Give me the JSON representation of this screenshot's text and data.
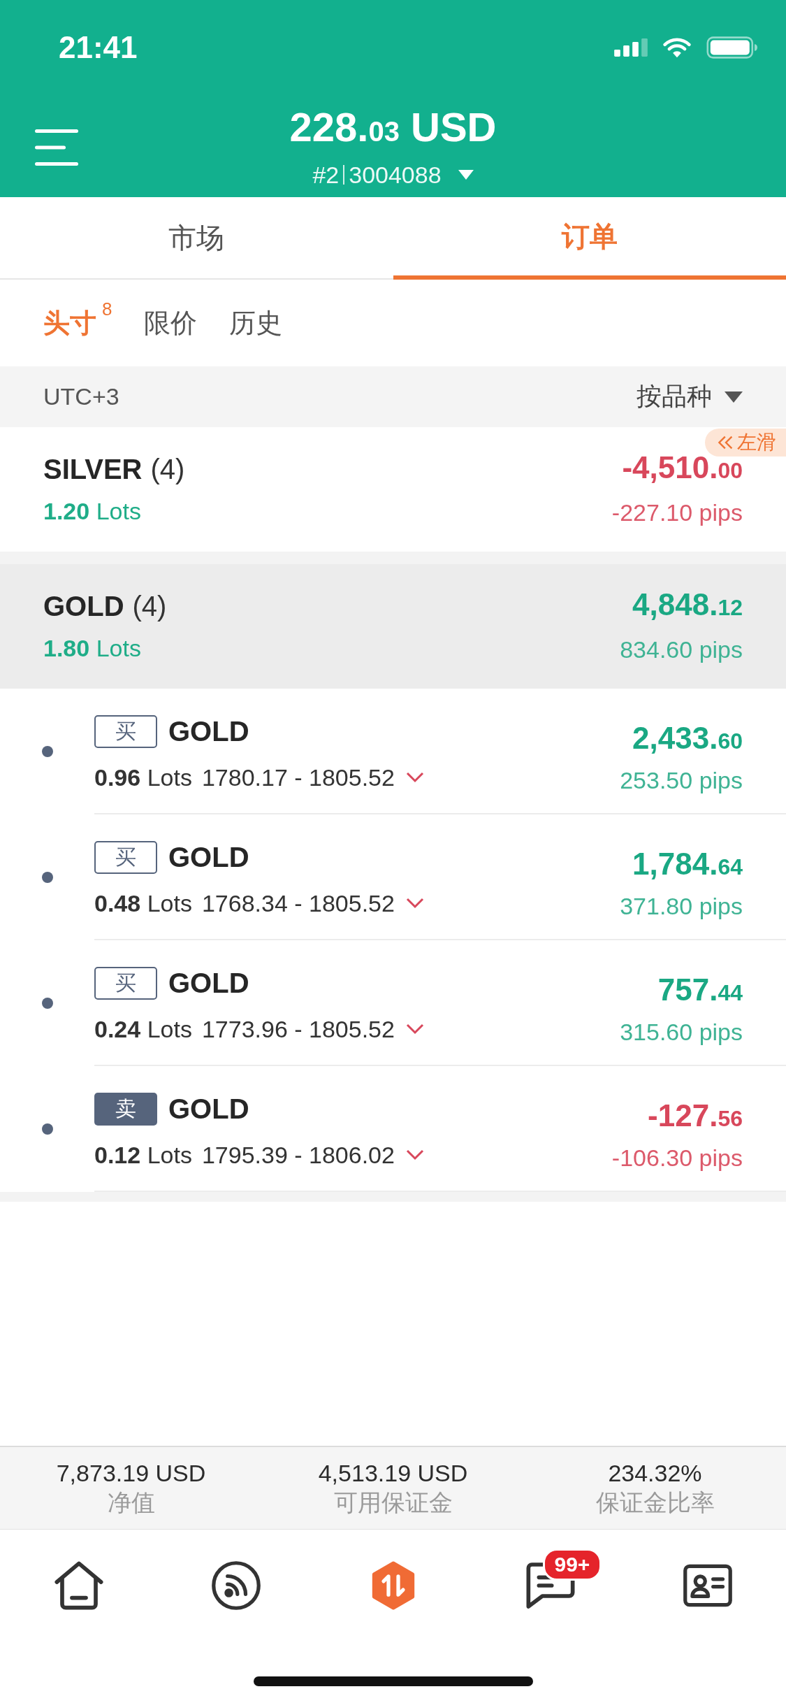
{
  "status_bar": {
    "time": "21:41"
  },
  "header": {
    "balance": {
      "whole": "228.",
      "fraction": "03",
      "currency": "USD"
    },
    "account": {
      "number": "#2",
      "id": "3004088"
    }
  },
  "tabs": [
    {
      "label": "市场",
      "selected": false
    },
    {
      "label": "订单",
      "selected": true
    }
  ],
  "sub_tabs": [
    {
      "label": "头寸",
      "count": "8",
      "selected": true
    },
    {
      "label": "限价",
      "selected": false
    },
    {
      "label": "历史",
      "selected": false
    }
  ],
  "filter_bar": {
    "timezone": "UTC+3",
    "sort": "按品种"
  },
  "groups": [
    {
      "symbol": "SILVER",
      "count": "(4)",
      "lots": "1.20",
      "lots_unit": "Lots",
      "pnl_whole": "-4,510.",
      "pnl_fraction": "00",
      "pips": "-227.10 pips",
      "positive": false,
      "expanded": false,
      "swipe_hint": "左滑"
    },
    {
      "symbol": "GOLD",
      "count": "(4)",
      "lots": "1.80",
      "lots_unit": "Lots",
      "pnl_whole": "4,848.",
      "pnl_fraction": "12",
      "pips": "834.60 pips",
      "positive": true,
      "expanded": true,
      "orders": [
        {
          "kind": "buy",
          "side_label": "买",
          "symbol": "GOLD",
          "lots": "0.96",
          "lots_unit": "Lots",
          "prices": "1780.17 - 1805.52",
          "pnl_whole": "2,433.",
          "pnl_fraction": "60",
          "pips": "253.50 pips",
          "positive": true
        },
        {
          "kind": "buy",
          "side_label": "买",
          "symbol": "GOLD",
          "lots": "0.48",
          "lots_unit": "Lots",
          "prices": "1768.34 - 1805.52",
          "pnl_whole": "1,784.",
          "pnl_fraction": "64",
          "pips": "371.80 pips",
          "positive": true
        },
        {
          "kind": "buy",
          "side_label": "买",
          "symbol": "GOLD",
          "lots": "0.24",
          "lots_unit": "Lots",
          "prices": "1773.96 - 1805.52",
          "pnl_whole": "757.",
          "pnl_fraction": "44",
          "pips": "315.60 pips",
          "positive": true
        },
        {
          "kind": "sell",
          "side_label": "卖",
          "symbol": "GOLD",
          "lots": "0.12",
          "lots_unit": "Lots",
          "prices": "1795.39 - 1806.02",
          "pnl_whole": "-127.",
          "pnl_fraction": "56",
          "pips": "-106.30 pips",
          "positive": false
        }
      ]
    }
  ],
  "summary": [
    {
      "value": "7,873.19 USD",
      "label": "净值"
    },
    {
      "value": "4,513.19 USD",
      "label": "可用保证金"
    },
    {
      "value": "234.32%",
      "label": "保证金比率"
    }
  ],
  "bottom_nav": [
    {
      "kind": "home",
      "selected": false
    },
    {
      "kind": "feed",
      "selected": false
    },
    {
      "kind": "trade",
      "selected": true
    },
    {
      "kind": "messages",
      "selected": false,
      "badge": "99+"
    },
    {
      "kind": "profile",
      "selected": false
    }
  ]
}
